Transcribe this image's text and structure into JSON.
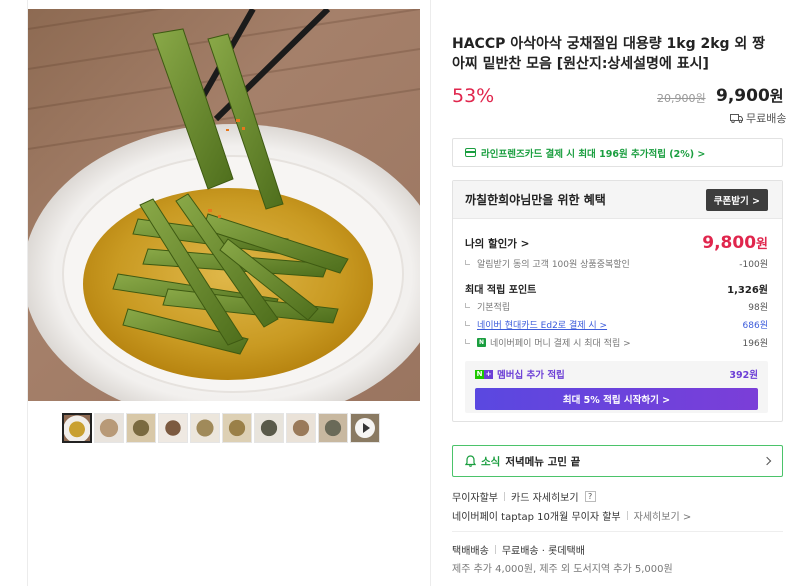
{
  "product": {
    "title": "HACCP 아삭아삭 궁채절임 대용량 1kg 2kg 외 짱아찌 밑반찬 모음 [원산지:상세설명에 표시]",
    "discount_rate": "53%",
    "original_price": "20,900원",
    "sale_price": "9,900",
    "sale_price_unit": "원",
    "shipping": "무료배송"
  },
  "card_promo": "라인프렌즈카드 결제 시 최대 196원 추가적립 (2%) >",
  "benefits": {
    "title": "까칠한희야님만을 위한 혜택",
    "coupon_button": "쿠폰받기 >",
    "my_discount_label": "나의 할인가 >",
    "my_discount_price": "9,800",
    "my_discount_unit": "원",
    "alarm_label": "알림받기 동의 고객 100원 상품중복할인",
    "alarm_value": "-100원",
    "points_label": "최대 적립 포인트",
    "points_value": "1,326원",
    "basic_label": "기본적립",
    "basic_value": "98원",
    "hyundai_label": "네이버 현대카드 Ed2로 결제 시 >",
    "hyundai_value": "686원",
    "npay_label": "네이버페이 머니 결제 시 최대 적립 >",
    "npay_value": "196원",
    "npay_badge": "N",
    "member_label": "멤버십 추가 적립",
    "member_value": "392원",
    "member_button": "최대 5% 적립 시작하기 >"
  },
  "news": {
    "tag": "소식",
    "text": "저녁메뉴 고민 끝"
  },
  "installment": {
    "label": "무이자할부",
    "card_info": "카드 자세히보기",
    "qmark": "?",
    "npay_text": "네이버페이 taptap 10개월 무이자 할부",
    "detail": "자세히보기 >"
  },
  "delivery": {
    "label": "택배배송",
    "type": "무료배송 · 롯데택배",
    "extra": "제주 추가 4,000원, 제주 외 도서지역 추가 5,000원"
  },
  "thumbnails": [
    "thumb-1",
    "thumb-2",
    "thumb-3",
    "thumb-4",
    "thumb-5",
    "thumb-6",
    "thumb-7",
    "thumb-8",
    "thumb-9",
    "thumb-10"
  ],
  "colors": {
    "discount_red": "#e0264d",
    "naver_green": "#1a9e3f",
    "membership_purple": "#6c3fd6"
  }
}
